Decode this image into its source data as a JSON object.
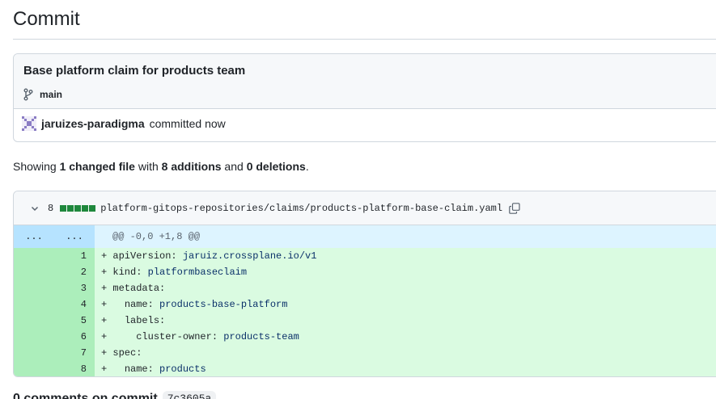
{
  "page": {
    "title": "Commit"
  },
  "commit": {
    "message": "Base platform claim for products team",
    "branch": "main",
    "author": "jaruizes-paradigma",
    "action": "committed now"
  },
  "summary": {
    "prefix": "Showing ",
    "files": "1 changed file",
    "with": " with ",
    "additions": "8 additions",
    "and": " and ",
    "deletions": "0 deletions",
    "suffix": "."
  },
  "file": {
    "change_count": "8",
    "path": "platform-gitops-repositories/claims/products-platform-base-claim.yaml",
    "hunk": {
      "old_ellipsis": "...",
      "new_ellipsis": "...",
      "header": "@@ -0,0 +1,8 @@"
    },
    "lines": [
      {
        "n": "1",
        "sign": "+ ",
        "key": "apiVersion:",
        "val": " jaruiz.crossplane.io/v1"
      },
      {
        "n": "2",
        "sign": "+ ",
        "key": "kind:",
        "val": " platformbaseclaim"
      },
      {
        "n": "3",
        "sign": "+ ",
        "key": "metadata:",
        "val": ""
      },
      {
        "n": "4",
        "sign": "+   ",
        "key": "name:",
        "val": " products-base-platform"
      },
      {
        "n": "5",
        "sign": "+   ",
        "key": "labels:",
        "val": ""
      },
      {
        "n": "6",
        "sign": "+     ",
        "key": "cluster-owner:",
        "val": " products-team"
      },
      {
        "n": "7",
        "sign": "+ ",
        "key": "spec:",
        "val": ""
      },
      {
        "n": "8",
        "sign": "+   ",
        "key": "name:",
        "val": " products"
      }
    ]
  },
  "comments": {
    "label": "0 comments on commit",
    "sha": "7c3605a"
  },
  "colors": {
    "addition": "#1f883d",
    "added_bg": "#dafbe1",
    "hunk_bg": "#ddf4ff"
  }
}
